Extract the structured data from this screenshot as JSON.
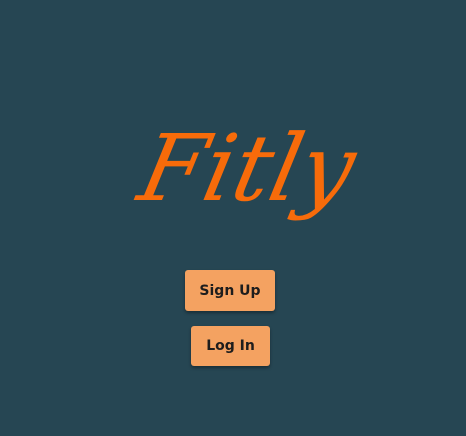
{
  "app": {
    "title": "Fitly",
    "background_color": "#264653",
    "logo_color": "#F76B0A"
  },
  "actions": {
    "signup_label": "Sign Up",
    "login_label": "Log In",
    "button_color": "#F4A261"
  }
}
